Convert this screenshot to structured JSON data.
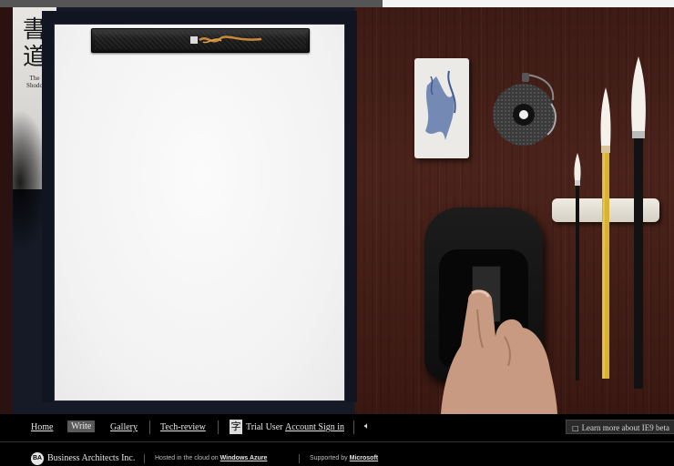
{
  "logo": {
    "kanji": "書道",
    "sub_line1": "The",
    "sub_line2": "Shodo"
  },
  "nav": {
    "items": [
      {
        "label": "Home",
        "active": false
      },
      {
        "label": "Write",
        "active": true
      },
      {
        "label": "Gallery",
        "active": false
      },
      {
        "label": "Tech-review",
        "active": false
      }
    ],
    "user_label": "Trial User",
    "sign_in_label": "Account Sign in",
    "sound_icon": "speaker-icon",
    "ie_button_label": "Learn more about IE9 beta"
  },
  "footer": {
    "company": "Business Architects Inc.",
    "company_logo_text": "BA",
    "hosted_prefix": "Hosted in the cloud on",
    "hosted_link": "Windows Azure",
    "supported_prefix": "Supported by",
    "supported_link": "Microsoft"
  },
  "colors": {
    "background": "#000000",
    "desk_wood": "#4a221b",
    "paper": "#f4f4f4",
    "frame": "#151a26",
    "nav_active": "#5a5a5a"
  }
}
